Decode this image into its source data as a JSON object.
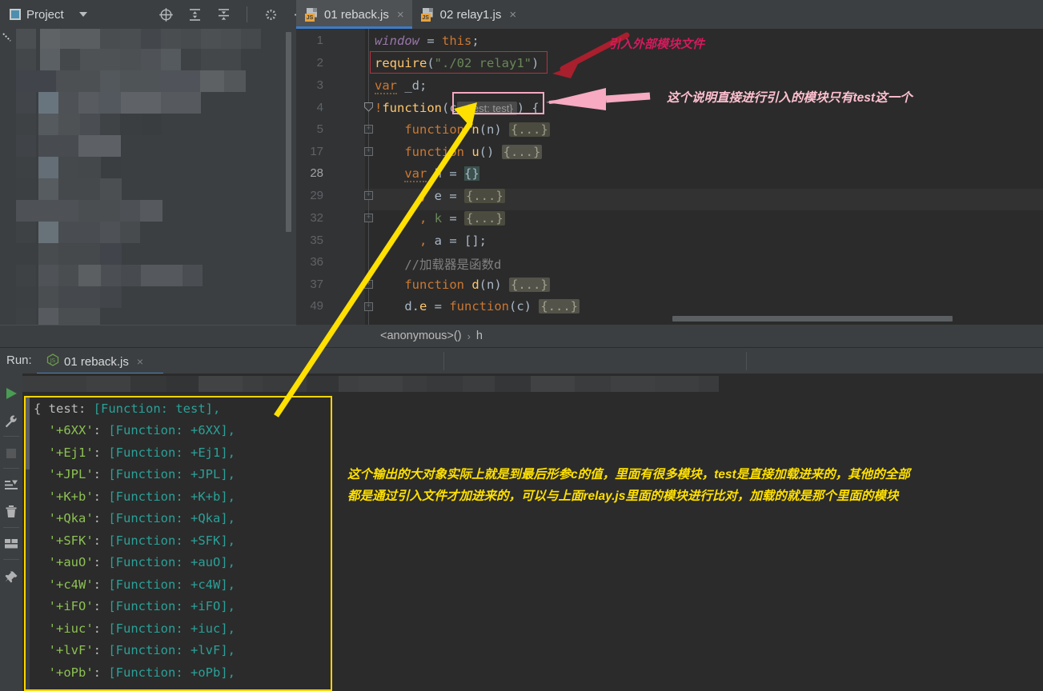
{
  "topbar": {
    "project_label": "Project",
    "icons": [
      "locate-icon",
      "expand-all-icon",
      "collapse-all-icon",
      "settings-gear-icon",
      "minimize-icon"
    ],
    "project_icon": "project-panel-icon",
    "caret_icon": "chevron-down-icon"
  },
  "tabs": [
    {
      "label": "01 reback.js",
      "icon": "js-file-icon",
      "close": "×",
      "active": true
    },
    {
      "label": "02 relay1.js",
      "icon": "js-file-icon",
      "close": "×",
      "active": false
    }
  ],
  "editor": {
    "gutter_numbers": [
      "1",
      "2",
      "3",
      "4",
      "5",
      "17",
      "28",
      "29",
      "32",
      "35",
      "36",
      "37",
      "49"
    ],
    "current_line": "28",
    "lines": [
      {
        "num": "1",
        "text": "window = this;"
      },
      {
        "num": "2",
        "text": "require(\"./02 relay1\")"
      },
      {
        "num": "3",
        "text": "var _d;"
      },
      {
        "num": "4",
        "text": "!function(c  : {test: test} ) {"
      },
      {
        "num": "5",
        "text": "    function n(n) {...}"
      },
      {
        "num": "17",
        "text": "    function u() {...}"
      },
      {
        "num": "28",
        "text": "    var h = {}"
      },
      {
        "num": "29",
        "text": "      , e = {...}"
      },
      {
        "num": "32",
        "text": "      , k = {...}"
      },
      {
        "num": "35",
        "text": "      , a = [];"
      },
      {
        "num": "36",
        "text": "    //加载器是函数d"
      },
      {
        "num": "37",
        "text": "    function d(n) {...}"
      },
      {
        "num": "49",
        "text": "    d.e = function(c) {...}"
      }
    ],
    "inlay_hint": ": {test: test}",
    "folded_placeholder": "{...}"
  },
  "breadcrumb": {
    "items": [
      "<anonymous>()",
      "h"
    ],
    "separator": "›"
  },
  "run_panel": {
    "label": "Run:",
    "tab_label": "01 reback.js",
    "tab_icon": "js-node-icon",
    "tab_close": "×",
    "side_icons": [
      "run-icon",
      "wrench-icon",
      "stop-icon",
      "export-icon",
      "trash-icon",
      "layout-icon",
      "pin-icon"
    ]
  },
  "console_output": [
    {
      "prefix": "{ ",
      "key": "test",
      "sep": ": ",
      "value": "[Function: test],"
    },
    {
      "prefix": "  ",
      "key": "'+6XX'",
      "sep": ": ",
      "value": "[Function: +6XX],"
    },
    {
      "prefix": "  ",
      "key": "'+Ej1'",
      "sep": ": ",
      "value": "[Function: +Ej1],"
    },
    {
      "prefix": "  ",
      "key": "'+JPL'",
      "sep": ": ",
      "value": "[Function: +JPL],"
    },
    {
      "prefix": "  ",
      "key": "'+K+b'",
      "sep": ": ",
      "value": "[Function: +K+b],"
    },
    {
      "prefix": "  ",
      "key": "'+Qka'",
      "sep": ": ",
      "value": "[Function: +Qka],"
    },
    {
      "prefix": "  ",
      "key": "'+SFK'",
      "sep": ": ",
      "value": "[Function: +SFK],"
    },
    {
      "prefix": "  ",
      "key": "'+auO'",
      "sep": ": ",
      "value": "[Function: +auO],"
    },
    {
      "prefix": "  ",
      "key": "'+c4W'",
      "sep": ": ",
      "value": "[Function: +c4W],"
    },
    {
      "prefix": "  ",
      "key": "'+iFO'",
      "sep": ": ",
      "value": "[Function: +iFO],"
    },
    {
      "prefix": "  ",
      "key": "'+iuc'",
      "sep": ": ",
      "value": "[Function: +iuc],"
    },
    {
      "prefix": "  ",
      "key": "'+lvF'",
      "sep": ": ",
      "value": "[Function: +lvF],"
    },
    {
      "prefix": "  ",
      "key": "'+oPb'",
      "sep": ": ",
      "value": "[Function: +oPb],"
    }
  ],
  "annotations": {
    "red_note": "引入外部模块文件",
    "pink_note": "这个说明直接进行引入的模块只有test这一个",
    "yellow_note_line1": "这个输出的大对象实际上就是到最后形参c的值，里面有很多模块，test是直接加载进来的，其他的全部",
    "yellow_note_line2": "都是通过引入文件才加进来的，可以与上面relay.js里面的模块进行比对，加载的就是那个里面的模块"
  },
  "colors": {
    "accent_blue": "#3d7cc9",
    "annotation_red": "#d61a5c",
    "annotation_pink": "#ffc0d0",
    "annotation_yellow": "#ffe000",
    "arrow_red": "#a81f2d",
    "editor_bg": "#2b2b2b",
    "chrome_bg": "#3c3f41"
  }
}
